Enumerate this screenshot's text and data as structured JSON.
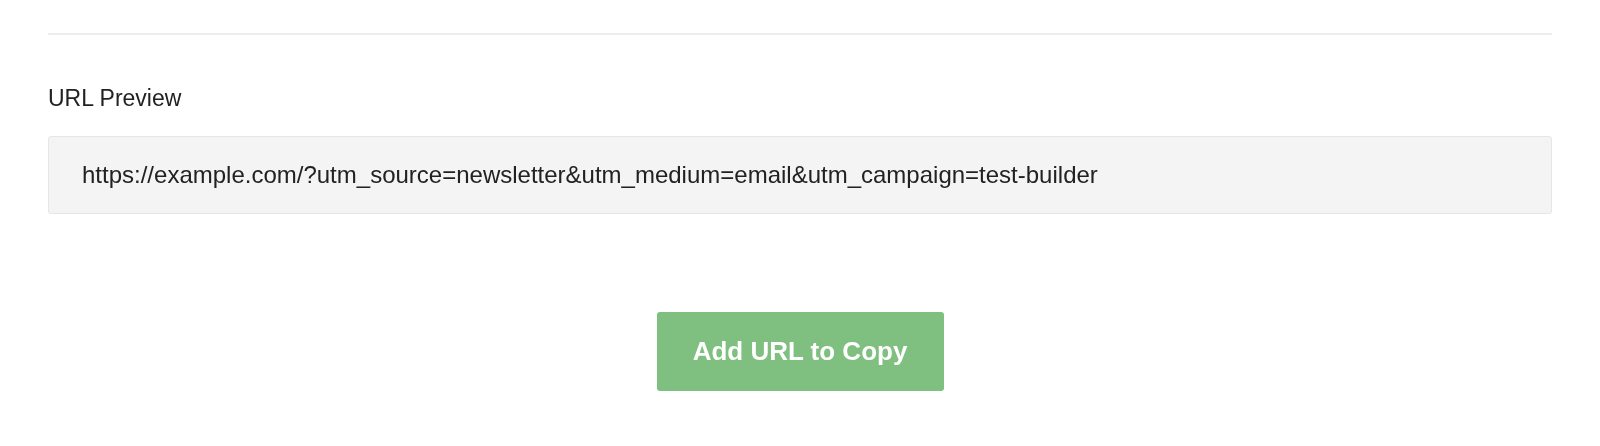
{
  "url_preview": {
    "label": "URL Preview",
    "value": "https://example.com/?utm_source=newsletter&utm_medium=email&utm_campaign=test-builder"
  },
  "button": {
    "label": "Add URL to Copy"
  }
}
